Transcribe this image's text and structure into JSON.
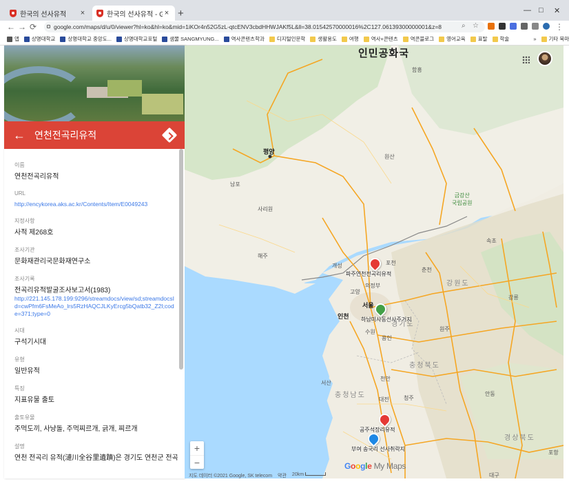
{
  "browser": {
    "tabs": [
      {
        "title": "한국의 선사유적",
        "close": "×"
      },
      {
        "title": "한국의 선사유적 - Google 내 지",
        "close": "×"
      }
    ],
    "new_tab": "+",
    "window_controls": [
      "—",
      "□",
      "✕"
    ],
    "url": "google.com/maps/d/u/0/viewer?hl=ko&hl=ko&mid=1iKOr4n52G5zL-qtcENV3cbdHHWJAKf5L&ll=38.01542570000016%2C127.06139300000001&z=8",
    "bookmarks": [
      "앱",
      "상명대학교",
      "상명대학교 중앙도...",
      "상명대학교포털",
      "샘물 SANGMYUNG...",
      "역사콘텐츠학과",
      "디지털인문학",
      "생활용도",
      "여행",
      "역사+콘텐츠",
      "역콘블로그",
      "영어교육",
      "표탈",
      "학술",
      "기타 북마크"
    ],
    "bookmarks_overflow": "»"
  },
  "panel": {
    "back_icon": "←",
    "title": "연천전곡리유적",
    "fields": [
      {
        "label": "이름",
        "value": "연천전곡리유적"
      },
      {
        "label": "URL",
        "link": "http://encykorea.aks.ac.kr/Contents/Item/E0049243"
      },
      {
        "label": "지정사항",
        "value": "사적 제268호"
      },
      {
        "label": "조사기관",
        "value": "문화재관리국문화재연구소"
      },
      {
        "label": "조사기록",
        "value": "전곡리유적발굴조사보고서(1983)",
        "link": "http://221.145.178.199:9296/streamdocs/view/sd;streamdocsId=cwPfm6FsMeAo_lrs5RzHAQCJLKyErcg5bQatb32_Z2I;code=371;type=0"
      },
      {
        "label": "시대",
        "value": "구석기시대"
      },
      {
        "label": "유형",
        "value": "일반유적"
      },
      {
        "label": "특징",
        "value": "지표유물 출토"
      },
      {
        "label": "출토유물",
        "value": "주먹도끼, 사냥돌, 주먹찌르개, 긁개, 찌르개"
      },
      {
        "label": "설명",
        "value": "연천 전곡리 유적(漣川全谷里遺蹟)은 경기도 연천군 전곡"
      }
    ]
  },
  "map": {
    "country_label": "인민공화국",
    "labels": {
      "pyongyang": "평양",
      "seoul": "서울",
      "incheon": "인천",
      "suwon": "수원",
      "gangwon": "강원도",
      "gyeonggi": "경기도",
      "chungbuk": "충청북도",
      "chungnam": "충청남도",
      "gyeongbuk": "경상북도",
      "kaesong": "개성",
      "chuncheon": "춘천",
      "wonju": "원주",
      "gangneung": "강릉",
      "daejeon": "대전",
      "cheongju": "청주",
      "hamhung": "함흥",
      "wonsan": "원산",
      "sokcho": "속초",
      "andong": "안동",
      "pohang": "포항",
      "daegu": "대구",
      "goyang": "고양",
      "uijeongbu": "의정부",
      "yongin": "용인",
      "cheonan": "천안",
      "seosan": "서산",
      "haeju": "해주",
      "sariwon": "사리원",
      "nampo": "남포",
      "geumgang": "금강산\n국립공원",
      "pocheon": "포천"
    },
    "markers": [
      {
        "label": "파주연천전곡리유적",
        "color": "red"
      },
      {
        "label": "하남미사동선사주거지",
        "color": "green"
      },
      {
        "label": "공주석장리유적",
        "color": "red"
      },
      {
        "label": "부여 송국리 선사취락지",
        "color": "blue"
      }
    ],
    "zoom_in": "+",
    "zoom_out": "−",
    "footer": {
      "data": "지도 데이터 ©2021 Google, SK telecom",
      "terms": "약관",
      "scale": "20km"
    },
    "logo_letters": [
      "G",
      "o",
      "o",
      "g",
      "l",
      "e"
    ],
    "logo_suffix": "My Maps"
  }
}
